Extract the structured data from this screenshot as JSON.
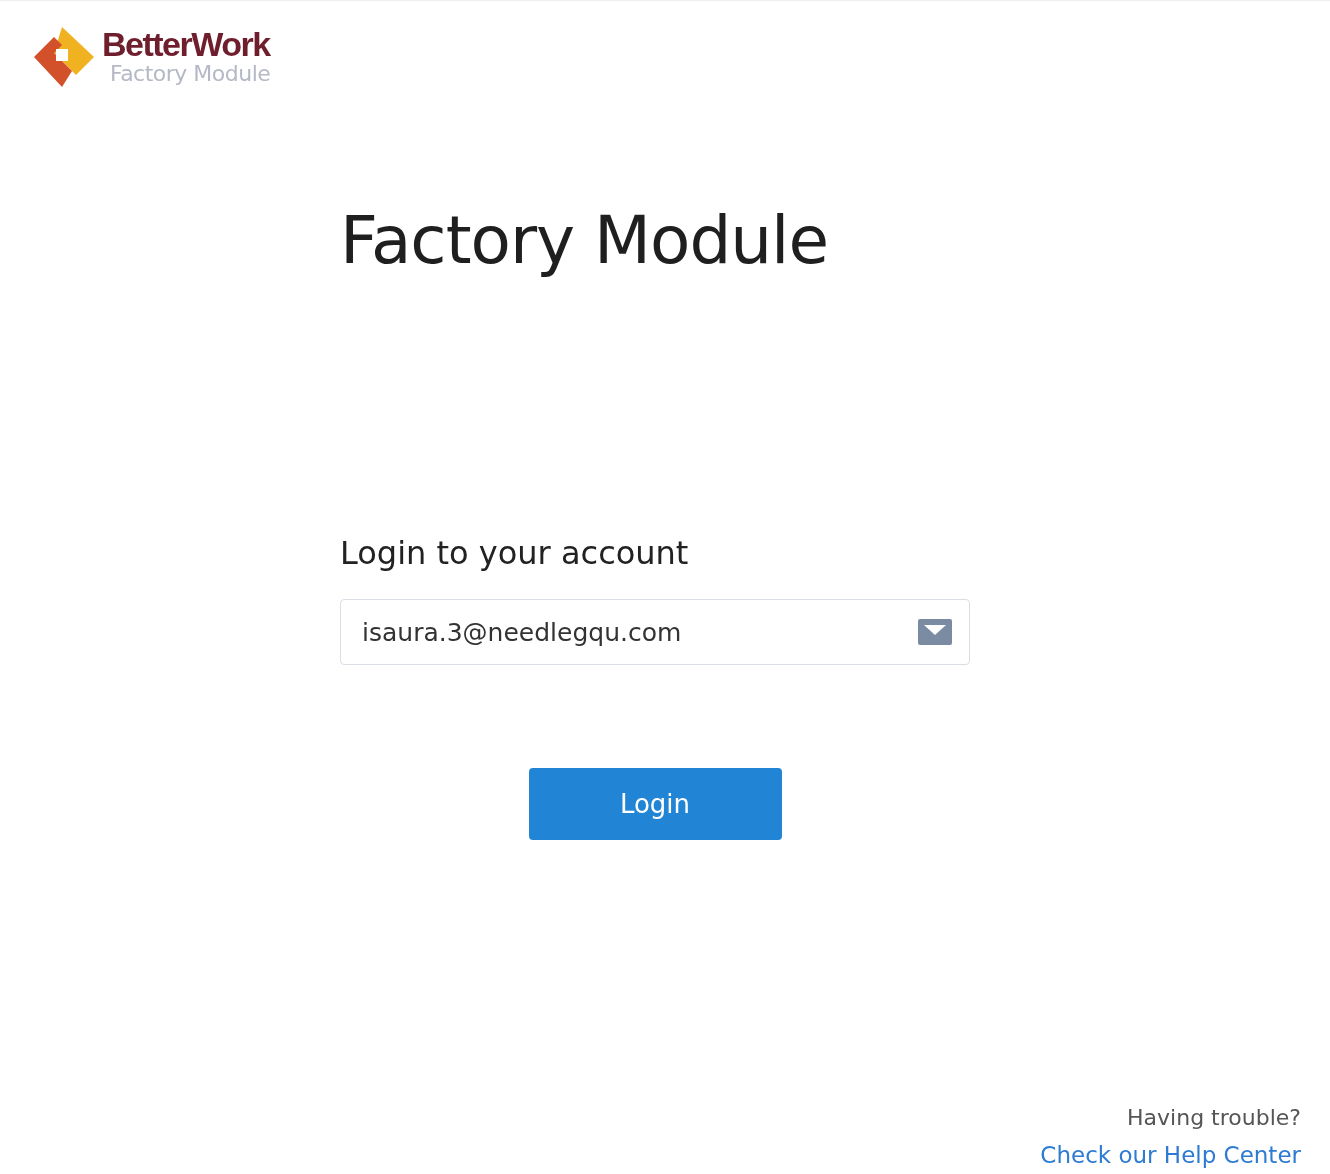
{
  "logo": {
    "brand": "BetterWork",
    "subtitle": "Factory Module"
  },
  "title": "Factory Module",
  "login": {
    "heading": "Login to your account",
    "email": {
      "value": "isaura.3@needlegqu.com"
    },
    "button": "Login"
  },
  "help": {
    "prompt": "Having trouble?",
    "link": "Check our Help Center"
  }
}
